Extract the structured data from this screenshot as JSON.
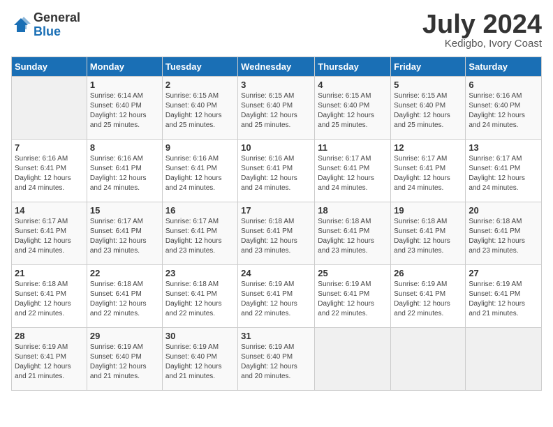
{
  "header": {
    "logo_general": "General",
    "logo_blue": "Blue",
    "title": "July 2024",
    "location": "Kedigbo, Ivory Coast"
  },
  "days_of_week": [
    "Sunday",
    "Monday",
    "Tuesday",
    "Wednesday",
    "Thursday",
    "Friday",
    "Saturday"
  ],
  "weeks": [
    [
      {
        "num": "",
        "info": ""
      },
      {
        "num": "1",
        "info": "Sunrise: 6:14 AM\nSunset: 6:40 PM\nDaylight: 12 hours\nand 25 minutes."
      },
      {
        "num": "2",
        "info": "Sunrise: 6:15 AM\nSunset: 6:40 PM\nDaylight: 12 hours\nand 25 minutes."
      },
      {
        "num": "3",
        "info": "Sunrise: 6:15 AM\nSunset: 6:40 PM\nDaylight: 12 hours\nand 25 minutes."
      },
      {
        "num": "4",
        "info": "Sunrise: 6:15 AM\nSunset: 6:40 PM\nDaylight: 12 hours\nand 25 minutes."
      },
      {
        "num": "5",
        "info": "Sunrise: 6:15 AM\nSunset: 6:40 PM\nDaylight: 12 hours\nand 25 minutes."
      },
      {
        "num": "6",
        "info": "Sunrise: 6:16 AM\nSunset: 6:40 PM\nDaylight: 12 hours\nand 24 minutes."
      }
    ],
    [
      {
        "num": "7",
        "info": "Sunrise: 6:16 AM\nSunset: 6:41 PM\nDaylight: 12 hours\nand 24 minutes."
      },
      {
        "num": "8",
        "info": "Sunrise: 6:16 AM\nSunset: 6:41 PM\nDaylight: 12 hours\nand 24 minutes."
      },
      {
        "num": "9",
        "info": "Sunrise: 6:16 AM\nSunset: 6:41 PM\nDaylight: 12 hours\nand 24 minutes."
      },
      {
        "num": "10",
        "info": "Sunrise: 6:16 AM\nSunset: 6:41 PM\nDaylight: 12 hours\nand 24 minutes."
      },
      {
        "num": "11",
        "info": "Sunrise: 6:17 AM\nSunset: 6:41 PM\nDaylight: 12 hours\nand 24 minutes."
      },
      {
        "num": "12",
        "info": "Sunrise: 6:17 AM\nSunset: 6:41 PM\nDaylight: 12 hours\nand 24 minutes."
      },
      {
        "num": "13",
        "info": "Sunrise: 6:17 AM\nSunset: 6:41 PM\nDaylight: 12 hours\nand 24 minutes."
      }
    ],
    [
      {
        "num": "14",
        "info": "Sunrise: 6:17 AM\nSunset: 6:41 PM\nDaylight: 12 hours\nand 24 minutes."
      },
      {
        "num": "15",
        "info": "Sunrise: 6:17 AM\nSunset: 6:41 PM\nDaylight: 12 hours\nand 23 minutes."
      },
      {
        "num": "16",
        "info": "Sunrise: 6:17 AM\nSunset: 6:41 PM\nDaylight: 12 hours\nand 23 minutes."
      },
      {
        "num": "17",
        "info": "Sunrise: 6:18 AM\nSunset: 6:41 PM\nDaylight: 12 hours\nand 23 minutes."
      },
      {
        "num": "18",
        "info": "Sunrise: 6:18 AM\nSunset: 6:41 PM\nDaylight: 12 hours\nand 23 minutes."
      },
      {
        "num": "19",
        "info": "Sunrise: 6:18 AM\nSunset: 6:41 PM\nDaylight: 12 hours\nand 23 minutes."
      },
      {
        "num": "20",
        "info": "Sunrise: 6:18 AM\nSunset: 6:41 PM\nDaylight: 12 hours\nand 23 minutes."
      }
    ],
    [
      {
        "num": "21",
        "info": "Sunrise: 6:18 AM\nSunset: 6:41 PM\nDaylight: 12 hours\nand 22 minutes."
      },
      {
        "num": "22",
        "info": "Sunrise: 6:18 AM\nSunset: 6:41 PM\nDaylight: 12 hours\nand 22 minutes."
      },
      {
        "num": "23",
        "info": "Sunrise: 6:18 AM\nSunset: 6:41 PM\nDaylight: 12 hours\nand 22 minutes."
      },
      {
        "num": "24",
        "info": "Sunrise: 6:19 AM\nSunset: 6:41 PM\nDaylight: 12 hours\nand 22 minutes."
      },
      {
        "num": "25",
        "info": "Sunrise: 6:19 AM\nSunset: 6:41 PM\nDaylight: 12 hours\nand 22 minutes."
      },
      {
        "num": "26",
        "info": "Sunrise: 6:19 AM\nSunset: 6:41 PM\nDaylight: 12 hours\nand 22 minutes."
      },
      {
        "num": "27",
        "info": "Sunrise: 6:19 AM\nSunset: 6:41 PM\nDaylight: 12 hours\nand 21 minutes."
      }
    ],
    [
      {
        "num": "28",
        "info": "Sunrise: 6:19 AM\nSunset: 6:41 PM\nDaylight: 12 hours\nand 21 minutes."
      },
      {
        "num": "29",
        "info": "Sunrise: 6:19 AM\nSunset: 6:40 PM\nDaylight: 12 hours\nand 21 minutes."
      },
      {
        "num": "30",
        "info": "Sunrise: 6:19 AM\nSunset: 6:40 PM\nDaylight: 12 hours\nand 21 minutes."
      },
      {
        "num": "31",
        "info": "Sunrise: 6:19 AM\nSunset: 6:40 PM\nDaylight: 12 hours\nand 20 minutes."
      },
      {
        "num": "",
        "info": ""
      },
      {
        "num": "",
        "info": ""
      },
      {
        "num": "",
        "info": ""
      }
    ]
  ]
}
